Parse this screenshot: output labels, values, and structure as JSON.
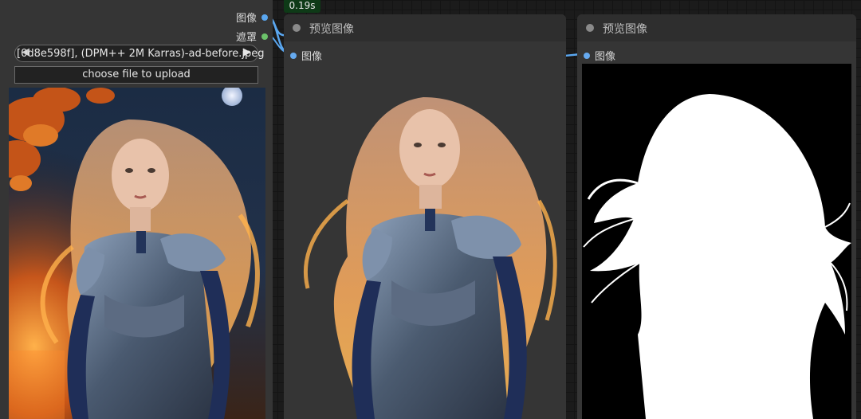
{
  "load_image_node": {
    "outputs": [
      {
        "label": "图像",
        "color": "#5aa7f0"
      },
      {
        "label": "遮罩",
        "color": "#6cc36a"
      }
    ],
    "file_value": "[0d8e598f], (DPM++ 2M Karras)-ad-before.jpeg",
    "upload_label": "choose file to upload"
  },
  "execution_time": "0.19s",
  "preview_nodes": [
    {
      "title": "预览图像",
      "input_label": "图像"
    },
    {
      "title": "预览图像",
      "input_label": "图像"
    }
  ],
  "colors": {
    "image_link": "#5aa7f0",
    "mask_link": "#6cc36a",
    "node_body": "#353535",
    "node_title": "#2e2e2e",
    "badge": "#0e3a17"
  },
  "icons": {
    "prev": "triangle-left",
    "next": "triangle-right",
    "status": "circle"
  }
}
